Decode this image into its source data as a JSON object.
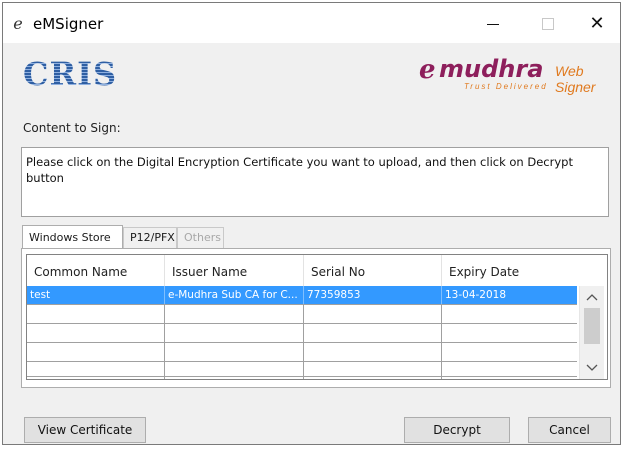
{
  "window": {
    "title": "eMSigner",
    "close_glyph": "✕"
  },
  "banner": {
    "cris_logo_text": "CRIS",
    "emudhra_logo": {
      "e": "e",
      "name": "mudhra",
      "product": "Web Signer",
      "tagline": "Trust Delivered"
    }
  },
  "content": {
    "label": "Content to Sign:",
    "text": "Please click on the Digital Encryption Certificate you want to upload, and then click on Decrypt button"
  },
  "tabs": [
    {
      "label": "Windows Store",
      "active": true
    },
    {
      "label": "P12/PFX",
      "active": false
    },
    {
      "label": "Others",
      "active": false,
      "disabled": true
    }
  ],
  "table": {
    "columns": [
      "Common Name",
      "Issuer Name",
      "Serial No",
      "Expiry Date"
    ],
    "rows": [
      {
        "common_name": "test",
        "issuer_name": "e-Mudhra Sub CA for C...",
        "serial_no": "77359853",
        "expiry_date": "13-04-2018",
        "selected": true
      }
    ]
  },
  "buttons": {
    "view_certificate": "View Certificate",
    "decrypt": "Decrypt",
    "cancel": "Cancel"
  },
  "icons": {
    "app": "emsigner-e-icon",
    "scroll_up": "chevron-up-icon",
    "scroll_down": "chevron-down-icon"
  },
  "colors": {
    "selection": "#3399ff",
    "cris_blue": "#2f5fa3",
    "emudhra_maroon": "#8e1f5c",
    "emudhra_orange": "#e07a1f"
  }
}
